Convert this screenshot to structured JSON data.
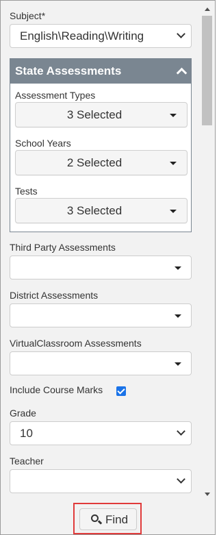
{
  "subject": {
    "label": "Subject*",
    "value": "English\\Reading\\Writing"
  },
  "state_assessments": {
    "title": "State Assessments",
    "assessment_types": {
      "label": "Assessment Types",
      "value": "3 Selected"
    },
    "school_years": {
      "label": "School Years",
      "value": "2 Selected"
    },
    "tests": {
      "label": "Tests",
      "value": "3 Selected"
    }
  },
  "third_party": {
    "label": "Third Party Assessments",
    "value": ""
  },
  "district": {
    "label": "District Assessments",
    "value": ""
  },
  "virtual_classroom": {
    "label": "VirtualClassroom Assessments",
    "value": ""
  },
  "course_marks": {
    "label": "Include Course Marks",
    "checked": true
  },
  "grade": {
    "label": "Grade",
    "value": "10"
  },
  "teacher": {
    "label": "Teacher",
    "value": ""
  },
  "find_button": {
    "label": "Find"
  },
  "colors": {
    "header_bg": "#7a8691",
    "checkbox": "#1a73e8",
    "highlight": "#e03a3a"
  },
  "icons": [
    "chevron-down-icon",
    "caret-down-icon",
    "chevron-up-icon",
    "search-icon",
    "checkbox-checked-icon"
  ]
}
